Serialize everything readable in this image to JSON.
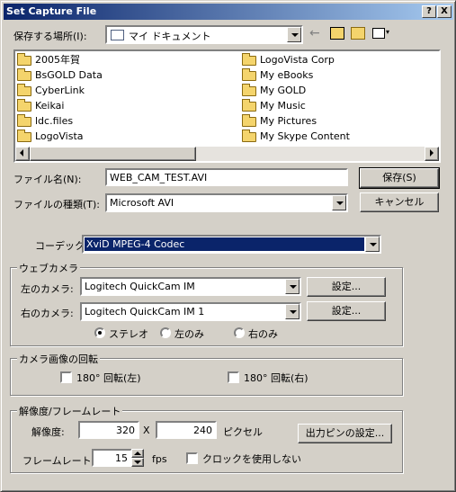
{
  "window": {
    "title": "Set Capture File",
    "help_label": "?",
    "close_label": "X"
  },
  "savein": {
    "label": "保存する場所(I):",
    "value": "マイ ドキュメント"
  },
  "files": {
    "col1": [
      "2005年賀",
      "BsGOLD Data",
      "CyberLink",
      "Keikai",
      "ldc.files",
      "LogoVista"
    ],
    "col2": [
      "LogoVista Corp",
      "My eBooks",
      "My GOLD",
      "My Music",
      "My Pictures",
      "My Skype Content"
    ]
  },
  "filename": {
    "label": "ファイル名(N):",
    "value": "WEB_CAM_TEST.AVI"
  },
  "filetype": {
    "label": "ファイルの種類(T):",
    "value": "Microsoft AVI"
  },
  "buttons": {
    "save": "保存(S)",
    "cancel": "キャンセル",
    "setting1": "設定...",
    "setting2": "設定...",
    "output_pin": "出力ピンの設定..."
  },
  "codec": {
    "label": "コーデック:",
    "value": "XviD MPEG-4 Codec"
  },
  "webcam": {
    "legend": "ウェブカメラ",
    "left_label": "左のカメラ:",
    "left_value": "Logitech QuickCam IM",
    "right_label": "右のカメラ:",
    "right_value": "Logitech QuickCam IM 1",
    "mode_stereo": "ステレオ",
    "mode_left": "左のみ",
    "mode_right": "右のみ"
  },
  "rotation": {
    "legend": "カメラ画像の回転",
    "left": "180° 回転(左)",
    "right": "180° 回転(右)"
  },
  "resolution": {
    "legend": "解像度/フレームレート",
    "res_label": "解像度:",
    "width": "320",
    "x": "X",
    "height": "240",
    "unit": "ピクセル",
    "fps_label": "フレームレート:",
    "fps": "15",
    "fps_unit": "fps",
    "noclock": "クロックを使用しない"
  }
}
